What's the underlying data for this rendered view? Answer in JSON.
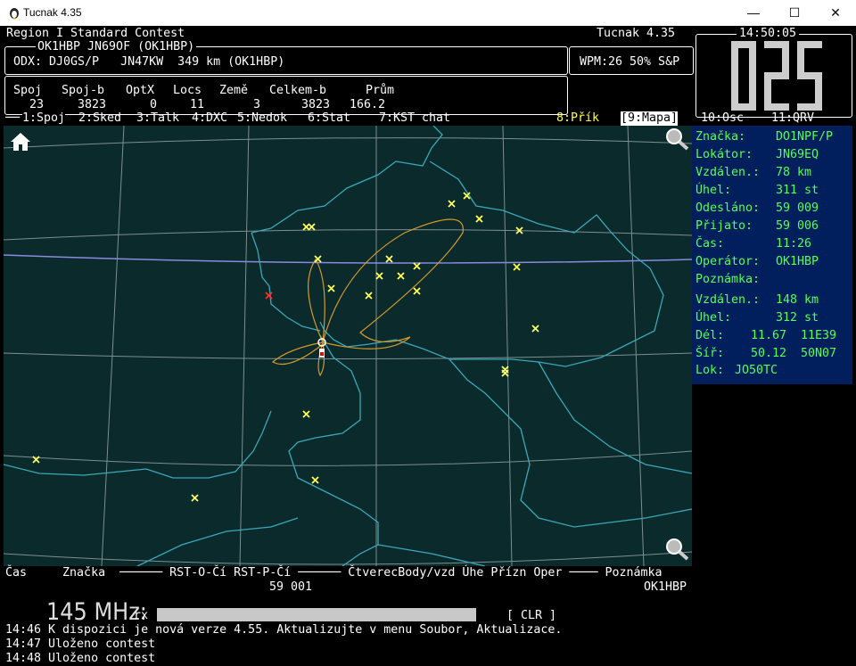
{
  "window": {
    "title": "Tucnak 4.35",
    "min": "—",
    "max": "☐",
    "close": "✕"
  },
  "header": {
    "contest_name": "Region I Standard Contest",
    "app_version": "Tucnak 4.35",
    "clock": "14:50:05",
    "station": "OK1HBP JN69OF (OK1HBP)",
    "odx": "ODX: DJ0GS/P   JN47KW  349 km (OK1HBP)",
    "wpm": "WPM:26 50% S&P",
    "big_counter": "025"
  },
  "stats": {
    "headers": [
      "Spoj",
      "Spoj-b",
      "OptX",
      "Locs",
      "Země",
      "Celkem-b",
      "Prům"
    ],
    "values": [
      "23",
      "3823",
      "0",
      "11",
      "3",
      "3823",
      "166.2"
    ]
  },
  "menu": {
    "items": [
      {
        "key": "1",
        "label": "1:Spoj"
      },
      {
        "key": "2",
        "label": "2:Sked"
      },
      {
        "key": "3",
        "label": "3:Talk"
      },
      {
        "key": "4",
        "label": "4:DXC"
      },
      {
        "key": "5",
        "label": "5:Nedok"
      },
      {
        "key": "6",
        "label": "6:Stat"
      },
      {
        "key": "7",
        "label": "7:KST chat"
      },
      {
        "key": "8",
        "label": "8:Přík"
      },
      {
        "key": "9",
        "label": "[9:Mapa]"
      },
      {
        "key": "10",
        "label": "10:Osc"
      },
      {
        "key": "11",
        "label": "11:QRV"
      }
    ]
  },
  "info": {
    "rows1": [
      {
        "label": "Značka:",
        "value": "DO1NPF/P"
      },
      {
        "label": "Lokátor:",
        "value": "JN69EQ"
      },
      {
        "label": "Vzdálen.:",
        "value": "78 km"
      },
      {
        "label": "Úhel:",
        "value": "311 st"
      },
      {
        "label": "Odesláno:",
        "value": "59 009"
      },
      {
        "label": "Přijato:",
        "value": "59 006"
      },
      {
        "label": "Čas:",
        "value": "11:26"
      },
      {
        "label": "Operátor:",
        "value": "OK1HBP"
      },
      {
        "label": "Poznámka:",
        "value": ""
      }
    ],
    "rows2": [
      {
        "label": "Vzdálen.:",
        "value": "148 km"
      },
      {
        "label": "Úhel:",
        "value": "312 st"
      },
      {
        "label": "Dél:",
        "value": "11.67  11E39"
      },
      {
        "label": "Šíř:",
        "value": "50.12  50N07"
      },
      {
        "label": "Lok:",
        "value": "JO50TC"
      }
    ]
  },
  "qso_columns": {
    "headers": "Čas     Značka  ────── RST-O-Čí RST-P-Čí ────── ČtverecBody/vzd Úhe Přízn Oper ──── Poznámka",
    "rst_o": "59 001",
    "oper": "OK1HBP"
  },
  "input": {
    "band": "145 MHz:",
    "mode": "rx",
    "clear": "[ CLR ]"
  },
  "log": [
    "14:46 K dispozici je nová verze 4.55. Aktualizujte v menu Soubor, Aktualizace.",
    "14:47 Uloženo contest",
    "14:48 Uloženo contest"
  ],
  "colors": {
    "map_bg": "#0a2a2c",
    "info_bg": "#001f5c",
    "label": "#55ff55",
    "highlight": "#ffff55"
  },
  "icons": {
    "home": "home-icon",
    "zoom_in": "zoom-in-icon",
    "zoom_out": "zoom-out-icon"
  }
}
